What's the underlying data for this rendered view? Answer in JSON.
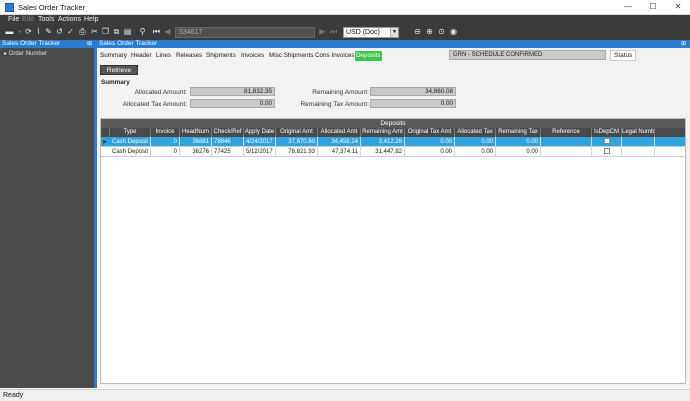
{
  "window": {
    "title": "Sales Order Tracker",
    "minimize": "—",
    "maximize": "☐",
    "close": "✕"
  },
  "menu": {
    "file": "File",
    "edit": "Edit",
    "tools": "Tools",
    "actions": "Actions",
    "help": "Help"
  },
  "toolbar": {
    "order_number": "534617",
    "currency": "USD (Doc)"
  },
  "tree": {
    "title": "Sales Order Tracker",
    "node": "Order Number"
  },
  "panel": {
    "title": "Sales Order Tracker"
  },
  "tabs": [
    "Summary",
    "Header",
    "Lines",
    "Releases",
    "Shipments",
    "Invoices",
    "Misc Shipments",
    "Cons Invoices",
    "Deposits"
  ],
  "status": {
    "value": "GRN -    SCHEDULE CONFIRMED",
    "label": "Status"
  },
  "retrieve_label": "Retrieve",
  "summary": {
    "title": "Summary",
    "allocated_amount_label": "Allocated Amount:",
    "allocated_amount": "81,832.35",
    "allocated_tax_label": "Allocated Tax Amount:",
    "allocated_tax": "0.00",
    "remaining_amount_label": "Remaining Amount:",
    "remaining_amount": "34,860.08",
    "remaining_tax_label": "Remaining Tax Amount:",
    "remaining_tax": "0.00"
  },
  "grid": {
    "title": "Deposits",
    "columns": [
      "Type",
      "Invoice",
      "HeadNum",
      "Check/Ref",
      "Apply Date",
      "Original Amt",
      "Allocated Amt",
      "Remaining Amt",
      "Original Tax Amt",
      "Allocated Tax",
      "Remaining Tax",
      "Reference",
      "IsDepCM",
      "Legal Numb"
    ],
    "rows": [
      {
        "type": "Cash Deposit",
        "invoice": "0",
        "headnum": "36881",
        "check": "78846",
        "date": "4/24/2017",
        "orig": "37,870.60",
        "alloc": "34,458.24",
        "remain": "3,412.26",
        "origtax": "0.00",
        "alloctax": "0.00",
        "remtax": "0.00",
        "ref": "",
        "legal": ""
      },
      {
        "type": "Cash Deposit",
        "invoice": "0",
        "headnum": "36276",
        "check": "77425",
        "date": "5/12/2017",
        "orig": "78,821.93",
        "alloc": "47,374.11",
        "remain": "31,447.82",
        "origtax": "0.00",
        "alloctax": "0.00",
        "remtax": "0.00",
        "ref": "",
        "legal": ""
      }
    ]
  },
  "statusbar": {
    "text": "Ready"
  },
  "colors": {
    "accent": "#2b7bd1",
    "active_tab": "#3fc14a",
    "selected_row": "#2ea3e0"
  }
}
